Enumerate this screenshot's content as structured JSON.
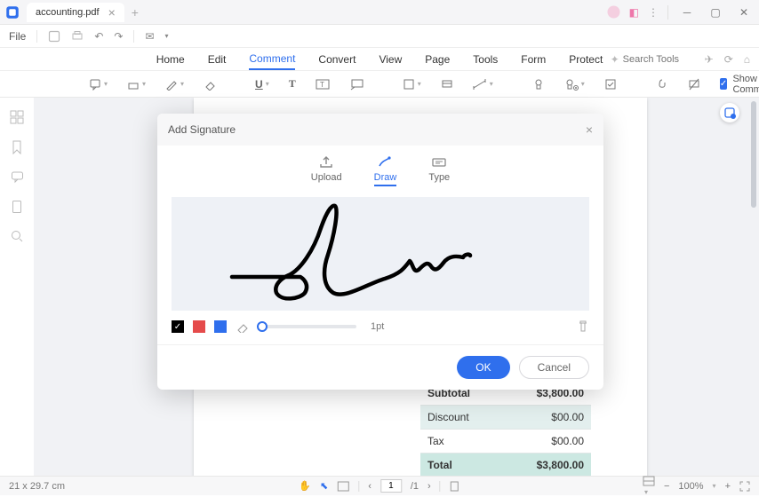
{
  "titlebar": {
    "tab_name": "accounting.pdf"
  },
  "quickbar": {
    "file_label": "File"
  },
  "menu": {
    "items": [
      "Home",
      "Edit",
      "Comment",
      "Convert",
      "View",
      "Page",
      "Tools",
      "Form",
      "Protect"
    ],
    "active_index": 2,
    "search_placeholder": "Search Tools"
  },
  "toolbar2": {
    "show_comment_label": "Show Comment"
  },
  "modal": {
    "title": "Add Signature",
    "tabs": {
      "upload": "Upload",
      "draw": "Draw",
      "type": "Type"
    },
    "thickness_label": "1pt",
    "colors": [
      "#000000",
      "#e54b4b",
      "#2f6fed"
    ],
    "ok_label": "OK",
    "cancel_label": "Cancel"
  },
  "invoice": {
    "rows": [
      {
        "label": "Subtotal",
        "value": "$3,800.00"
      },
      {
        "label": "Discount",
        "value": "$00.00"
      },
      {
        "label": "Tax",
        "value": "$00.00"
      },
      {
        "label": "Total",
        "value": "$3,800.00"
      }
    ]
  },
  "statusbar": {
    "dimensions": "21 x 29.7 cm",
    "page_current": "1",
    "page_total": "/1",
    "zoom": "100%"
  }
}
